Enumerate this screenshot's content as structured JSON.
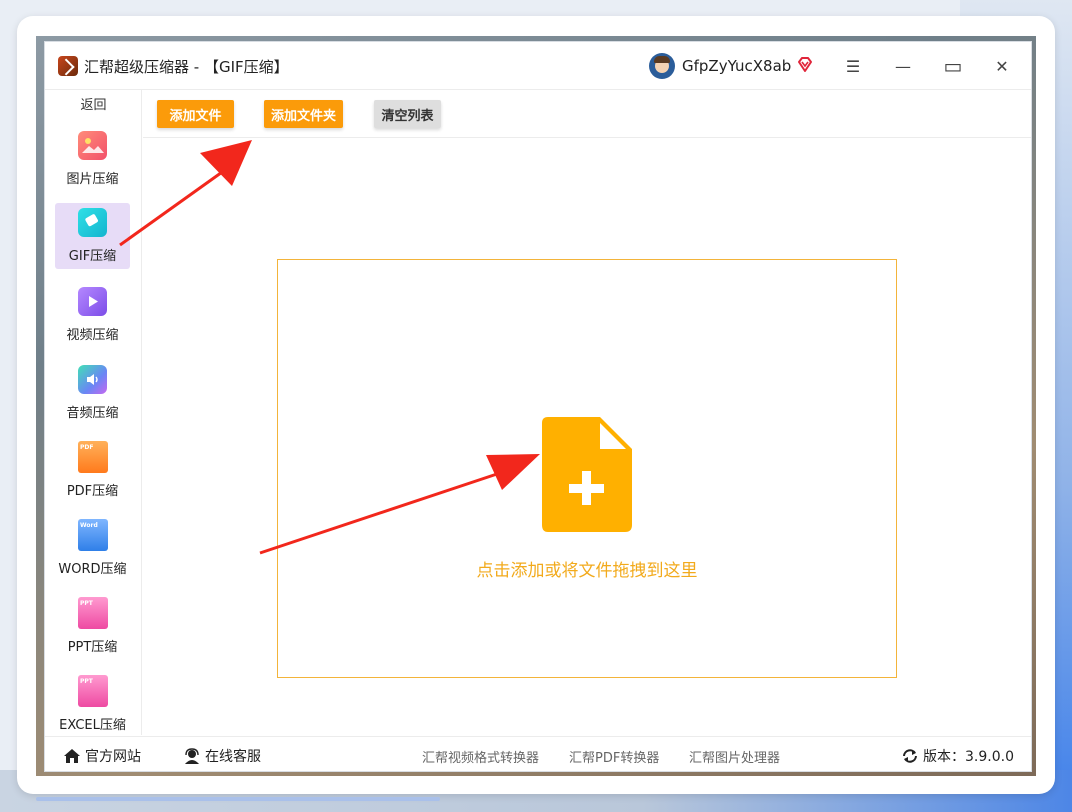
{
  "window": {
    "app_name": "汇帮超级压缩器",
    "module_title": " - 【GIF压缩】",
    "user_name": "GfpZyYucX8ab",
    "minimize_glyph": "—",
    "maximize_glyph": "▭",
    "close_glyph": "✕",
    "menu_glyph": "☰"
  },
  "sidebar": {
    "back_label": "返回",
    "items": [
      {
        "label": "图片压缩",
        "icon": "image-icon",
        "color": "#f06a5a"
      },
      {
        "label": "GIF压缩",
        "icon": "gif-icon",
        "color": "#1ec8d6",
        "active": true
      },
      {
        "label": "视频压缩",
        "icon": "video-play-icon",
        "color": "#9b6cf0"
      },
      {
        "label": "音频压缩",
        "icon": "audio-icon",
        "color": "#6aa7f2"
      },
      {
        "label": "PDF压缩",
        "icon": "pdf-file-icon",
        "color": "#ff8a2a",
        "tag": "PDF"
      },
      {
        "label": "WORD压缩",
        "icon": "word-file-icon",
        "color": "#3d8ef3",
        "tag": "Word"
      },
      {
        "label": "PPT压缩",
        "icon": "ppt-file-icon",
        "color": "#f05aa8",
        "tag": "PPT"
      },
      {
        "label": "EXCEL压缩",
        "icon": "excel-file-icon",
        "color": "#f05aa8",
        "tag": "PPT"
      }
    ]
  },
  "toolbar": {
    "add_file": "添加文件",
    "add_folder": "添加文件夹",
    "clear_list": "清空列表"
  },
  "dropzone": {
    "hint": "点击添加或将文件拖拽到这里",
    "accent": "#ffb000"
  },
  "bottombar": {
    "website": "官方网站",
    "support": "在线客服",
    "video_converter": "汇帮视频格式转换器",
    "pdf_converter": "汇帮PDF转换器",
    "image_processor": "汇帮图片处理器",
    "version_label": "版本：3.9.0.0"
  }
}
